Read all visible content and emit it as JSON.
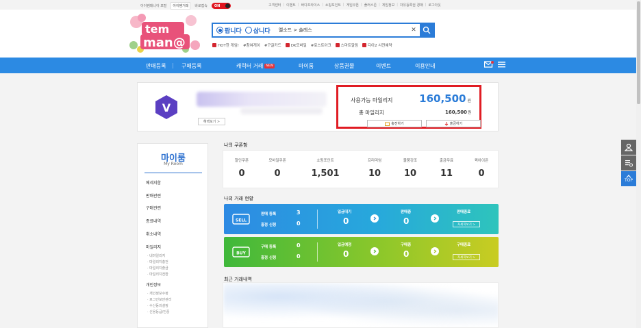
{
  "topbar": {
    "left": [
      "아이템매니아 포털",
      "아이템거래",
      "바로접속"
    ],
    "toggle": "ON",
    "right": [
      "고객센터",
      "이벤트",
      "바다프라이스",
      "쇼핑포인트",
      "게임쿠폰",
      "플러스존",
      "게임정보",
      "자유등록권 경매",
      "로그아웃"
    ]
  },
  "search": {
    "radio_sell": "팝니다",
    "radio_buy": "삽니다",
    "crumb": "엘소드 > 솔레스"
  },
  "tags": [
    "HOT한 게임!",
    "#참여게이",
    "#구글카드",
    "DK모바일",
    "#로스트아크",
    "스마트알림",
    "디아2 사전예약"
  ],
  "nav": {
    "sell": "판매등록",
    "buy": "구매등록",
    "char": "캐릭터 거래",
    "new_badge": "NEW",
    "myroom": "마이룸",
    "giftcard": "상품권몰",
    "event": "이벤트",
    "guide": "이용안내"
  },
  "profile": {
    "badge_letter": "V",
    "detail_btn": "혜택보기 >",
    "usable_label": "사용가능 마일리지",
    "usable_value": "160,500",
    "unit": "원",
    "total_label": "총 마일리지",
    "total_value": "160,500",
    "charge_btn": "충전하기",
    "withdraw_btn": "출금하기"
  },
  "side": {
    "title": "마이룸",
    "sub": "My Room",
    "items": [
      "메세지함",
      "판매관련",
      "구매관련",
      "종료내역",
      "취소내역",
      "마일리지"
    ],
    "mileage_sub": [
      "· 내마일리지",
      "· 마일리지충전",
      "· 마일리지출금",
      "· 마일리지전환"
    ],
    "personal": "개인정보",
    "personal_sub": [
      "· 개인정보수정",
      "· 로그인보안관리",
      "· 수신동의설정",
      "· 신용등급/인증"
    ]
  },
  "coupon": {
    "title": "나의 쿠폰함",
    "items": [
      {
        "label": "할인쿠폰",
        "value": "0"
      },
      {
        "label": "모바일쿠폰",
        "value": "0"
      },
      {
        "label": "쇼핑포인트",
        "value": "1,501"
      },
      {
        "label": "프리미엄",
        "value": "10"
      },
      {
        "label": "물품강조",
        "value": "10"
      },
      {
        "label": "출금무료",
        "value": "11"
      },
      {
        "label": "퀵아이콘",
        "value": "0"
      }
    ]
  },
  "trade": {
    "title": "나의 거래 현황",
    "sell": {
      "icon": "SELL",
      "reg_label": "판매 등록",
      "reg_value": "3",
      "req_label": "흥정 신청",
      "req_value": "0",
      "wait_label": "입금대기",
      "wait_value": "0",
      "ing_label": "판매중",
      "ing_value": "0",
      "done_label": "판매종료",
      "more": "자세히보기 >"
    },
    "buy": {
      "icon": "BUY",
      "reg_label": "구매 등록",
      "reg_value": "0",
      "req_label": "흥정 신청",
      "req_value": "0",
      "wait_label": "입금예정",
      "wait_value": "0",
      "ing_label": "구매중",
      "ing_value": "0",
      "done_label": "구매종료",
      "more": "자세히보기 >"
    }
  },
  "recent": {
    "title": "최근 거래내역"
  },
  "float": {
    "top": "TOP"
  }
}
